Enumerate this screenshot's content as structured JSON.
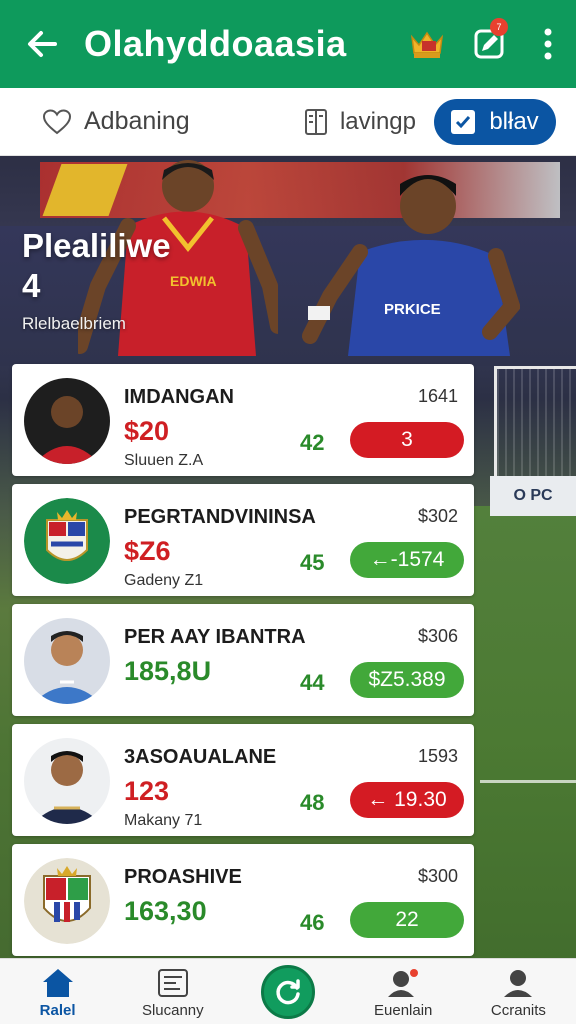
{
  "appbar": {
    "title": "Olahyddoaasia",
    "back_icon": "arrow-left-icon",
    "crown_icon": "crown-icon",
    "edit_icon": "edit-icon",
    "edit_badge": "7",
    "menu_icon": "more-vertical-icon"
  },
  "filters": {
    "favorite_label": "Adbaning",
    "view_label": "lavingp",
    "toggle_label": "blłav"
  },
  "hero": {
    "title_line1": "Plealiliwe",
    "title_line2": "4",
    "subtitle": "Rlelbaelbriem",
    "adboard_text": "O PC",
    "jersey1_text": "EDWIA",
    "jersey2_text": "PRKICE"
  },
  "cards": [
    {
      "name": "IMDANGAN",
      "value": "$20",
      "value_color": "red",
      "sub": "Sluuen Z.A",
      "num": "1641",
      "score": "42",
      "chip": "3",
      "chip_color": "red"
    },
    {
      "name": "PEGRTANDVININSA",
      "value": "$Z6",
      "value_color": "red",
      "sub": "Gadeny Z1",
      "num": "$302",
      "score": "45",
      "chip": "←-1574",
      "chip_color": "green"
    },
    {
      "name": "PER AAY IBANTRA",
      "value": "185,8U",
      "value_color": "green",
      "sub": "",
      "num": "$306",
      "score": "44",
      "chip": "$Z5.389",
      "chip_color": "green"
    },
    {
      "name": "3ASOAUALANE",
      "value": "123",
      "value_color": "red",
      "sub": "Makany 71",
      "num": "1593",
      "score": "48",
      "chip": "← 19.30",
      "chip_color": "red"
    },
    {
      "name": "PROASHIVE",
      "value": "163,30",
      "value_color": "green",
      "sub": "",
      "num": "$300",
      "score": "46",
      "chip": "22",
      "chip_color": "green"
    }
  ],
  "bottom_nav": {
    "items": [
      {
        "label": "Ralel",
        "icon": "home-icon"
      },
      {
        "label": "Slucanny",
        "icon": "stats-icon"
      },
      {
        "label": "",
        "icon": "refresh-icon"
      },
      {
        "label": "Euenlain",
        "icon": "user-alert-icon"
      },
      {
        "label": "Ccranits",
        "icon": "profile-icon"
      }
    ]
  },
  "colors": {
    "primary_green": "#0e9a5c",
    "accent_blue": "#0b55a3",
    "red": "#d41b23",
    "green": "#42a83a"
  }
}
